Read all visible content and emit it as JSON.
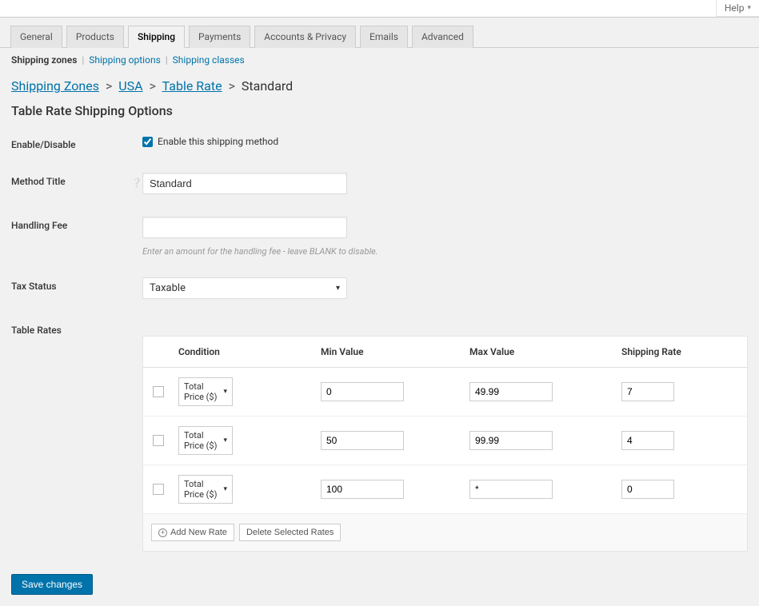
{
  "help_link": "Help",
  "tabs": [
    "General",
    "Products",
    "Shipping",
    "Payments",
    "Accounts & Privacy",
    "Emails",
    "Advanced"
  ],
  "active_tab_index": 2,
  "subnav": {
    "title": "Shipping zones",
    "items": [
      "Shipping options",
      "Shipping classes"
    ]
  },
  "breadcrumb": {
    "items": [
      "Shipping Zones",
      "USA",
      "Table Rate"
    ],
    "current": "Standard"
  },
  "section_title": "Table Rate Shipping Options",
  "fields": {
    "enable": {
      "label": "Enable/Disable",
      "checkbox_label": "Enable this shipping method",
      "checked": true
    },
    "method_title": {
      "label": "Method Title",
      "value": "Standard"
    },
    "handling_fee": {
      "label": "Handling Fee",
      "value": "",
      "help": "Enter an amount for the handling fee - leave BLANK to disable."
    },
    "tax_status": {
      "label": "Tax Status",
      "value": "Taxable"
    },
    "table_rates": {
      "label": "Table Rates"
    }
  },
  "table": {
    "headers": [
      "Condition",
      "Min Value",
      "Max Value",
      "Shipping Rate"
    ],
    "condition_options": [
      "Total Price ($)"
    ],
    "rows": [
      {
        "condition": "Total Price ($)",
        "min": "0",
        "max": "49.99",
        "rate": "7"
      },
      {
        "condition": "Total Price ($)",
        "min": "50",
        "max": "99.99",
        "rate": "4"
      },
      {
        "condition": "Total Price ($)",
        "min": "100",
        "max": "*",
        "rate": "0"
      }
    ],
    "actions": {
      "add": "Add New Rate",
      "delete": "Delete Selected Rates"
    }
  },
  "save_label": "Save changes"
}
